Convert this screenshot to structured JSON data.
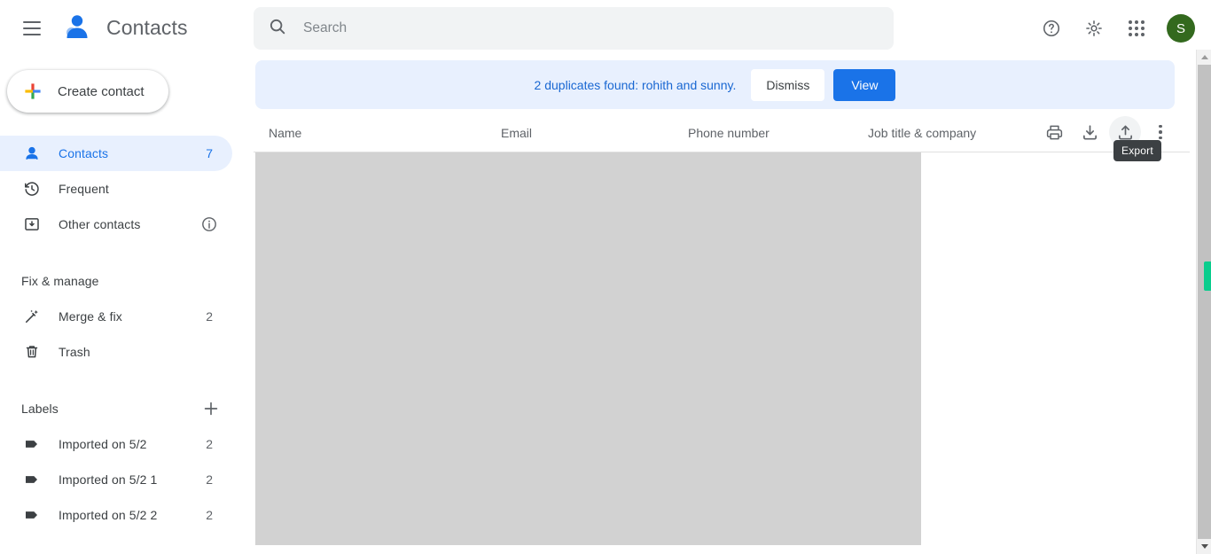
{
  "app": {
    "title": "Contacts",
    "accent_blue": "#1a73e8",
    "banner_bg": "#e8f0fe",
    "avatar_bg": "#33691e",
    "content_block_color": "#d2d2d2",
    "scrollbar_thumb_color": "#0acd8d"
  },
  "topbar": {
    "menu_icon": "hamburger-icon",
    "logo_icon": "contacts-logo-icon",
    "help_icon": "help-icon",
    "settings_icon": "gear-icon",
    "apps_icon": "apps-grid-icon",
    "avatar_initial": "S"
  },
  "search": {
    "placeholder": "Search",
    "value": "",
    "icon": "search-icon"
  },
  "sidebar": {
    "create_button": {
      "label": "Create contact",
      "icon": "google-plus-icon"
    },
    "nav": [
      {
        "label": "Contacts",
        "count": "7",
        "icon": "person-icon",
        "active": true
      },
      {
        "label": "Frequent",
        "count": "",
        "icon": "history-icon",
        "active": false
      },
      {
        "label": "Other contacts",
        "count": "",
        "icon": "archive-box-icon",
        "active": false,
        "info_icon": "info-icon"
      }
    ],
    "fix_manage": {
      "heading": "Fix & manage",
      "items": [
        {
          "label": "Merge & fix",
          "count": "2",
          "icon": "magic-wand-icon"
        },
        {
          "label": "Trash",
          "count": "",
          "icon": "trash-icon"
        }
      ]
    },
    "labels": {
      "heading": "Labels",
      "add_icon": "plus-icon",
      "items": [
        {
          "label": "Imported on 5/2",
          "count": "2",
          "icon": "label-tag-icon"
        },
        {
          "label": "Imported on 5/2 1",
          "count": "2",
          "icon": "label-tag-icon"
        },
        {
          "label": "Imported on 5/2 2",
          "count": "2",
          "icon": "label-tag-icon"
        }
      ]
    }
  },
  "banner": {
    "message": "2 duplicates found: rohith and sunny.",
    "dismiss_label": "Dismiss",
    "view_label": "View"
  },
  "table": {
    "columns": [
      "Name",
      "Email",
      "Phone number",
      "Job title & company"
    ],
    "rows": []
  },
  "toolbar": {
    "print_icon": "printer-icon",
    "import_icon": "import-download-icon",
    "export_icon": "export-upload-icon",
    "more_icon": "more-vertical-icon",
    "tooltip": "Export"
  },
  "scrollbar": {
    "up_icon": "triangle-up-icon",
    "down_icon": "triangle-down-icon"
  }
}
